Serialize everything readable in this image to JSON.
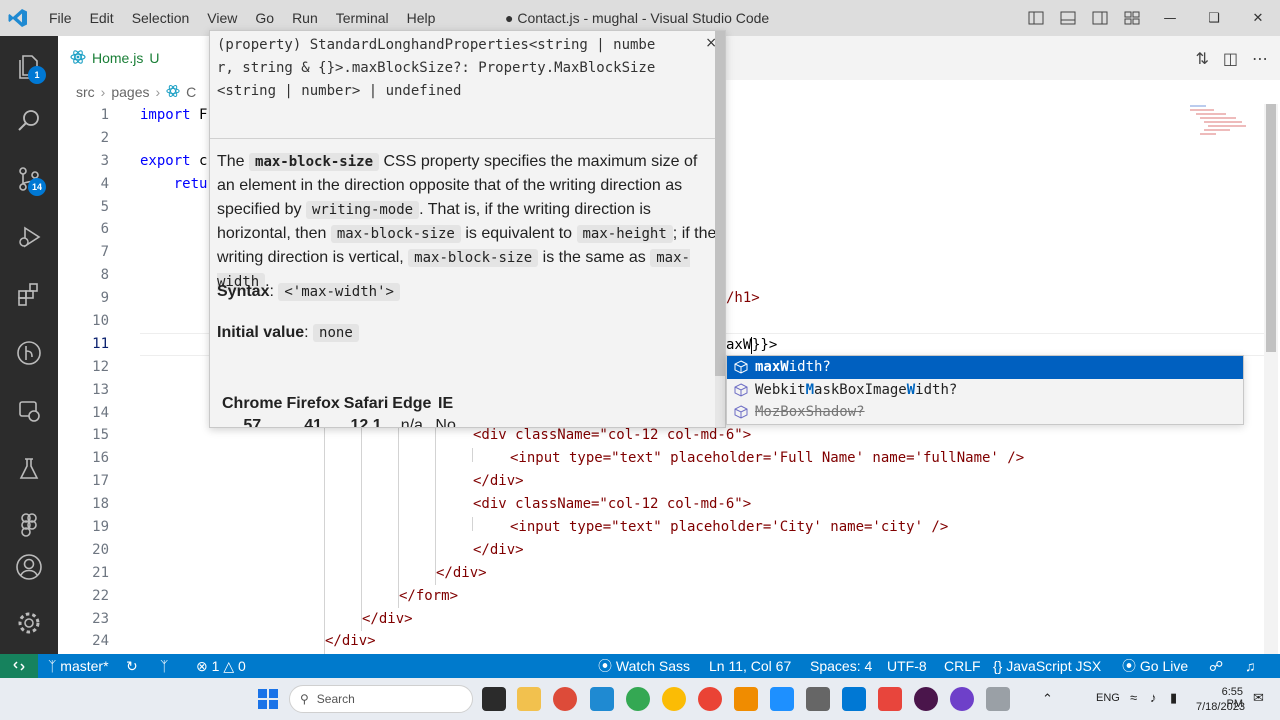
{
  "window": {
    "title": "● Contact.js - mughal - Visual Studio Code",
    "menu": [
      "File",
      "Edit",
      "Selection",
      "View",
      "Go",
      "Run",
      "Terminal",
      "Help"
    ]
  },
  "activity": {
    "explorer_badge": "1",
    "scm_badge": "14"
  },
  "tab": {
    "label": "Home.js",
    "status": "U"
  },
  "breadcrumb": {
    "parts": [
      "src",
      "pages",
      "C"
    ]
  },
  "editor": {
    "line_numbers": [
      "1",
      "2",
      "3",
      "4",
      "5",
      "6",
      "7",
      "8",
      "9",
      "10",
      "11",
      "12",
      "13",
      "14",
      "15",
      "16",
      "17",
      "18",
      "19",
      "20",
      "21",
      "22",
      "23",
      "24"
    ],
    "active_line": "11",
    "lines": {
      "l1_kw": "import",
      "l1_rest": " F",
      "l3_kw": "export",
      "l3_rest": " c",
      "l4": "    retu",
      "l9_tail": "/h1>",
      "l11_tail_a": "axW",
      "l11_tail_b": "}}>",
      "l15": "<div className=\"col-12 col-md-6\">",
      "l16": "<input type=\"text\" placeholder='Full Name' name='fullName' />",
      "l17": "</div>",
      "l18": "<div className=\"col-12 col-md-6\">",
      "l19": "<input type=\"text\" placeholder='City' name='city' />",
      "l20": "</div>",
      "l21": "</div>",
      "l22": "</form>",
      "l23": "</div>",
      "l24": "</div>"
    }
  },
  "hover": {
    "signature_1": "(property) StandardLonghandProperties<string | numbe",
    "signature_2": "r, string & {}>.maxBlockSize?: Property.MaxBlockSize",
    "signature_3": "<string | number> | undefined",
    "close": "×",
    "desc": {
      "p1": "The ",
      "c1": "max-block-size",
      "p2": " CSS property specifies the maximum size of an element in the direction opposite that of the writing direction as specified by ",
      "c2": "writing-mode",
      "p3": ". That is, if the writing direction is horizontal, then ",
      "c3": "max-block-size",
      "p4": " is equivalent to ",
      "c4": "max-height",
      "p5": "; if the writing direction is vertical, ",
      "c5": "max-block-size",
      "p6": " is the same as ",
      "c6": "max-width",
      "p7": "."
    },
    "syntax_label": "Syntax",
    "syntax_value": "<'max-width'>",
    "initial_label": "Initial value",
    "initial_value": "none",
    "compat_headers": [
      "Chrome",
      "Firefox",
      "Safari",
      "Edge",
      "IE"
    ],
    "compat_values": [
      "57",
      "41",
      "12.1",
      "n/a",
      "No"
    ]
  },
  "suggest": {
    "items": [
      {
        "pre": "",
        "hl1": "maxW",
        "mid": "idth?",
        "hl2": "",
        "post": ""
      },
      {
        "pre": "Webkit",
        "hl1": "M",
        "mid": "askBoxImage",
        "hl2": "W",
        "post": "idth?"
      },
      {
        "pre": "",
        "hl1": "",
        "mid": "MozBoxShadow?",
        "hl2": "",
        "post": ""
      }
    ]
  },
  "status": {
    "branch": "master*",
    "errors": "1",
    "warnings": "0",
    "watch_sass": "Watch Sass",
    "position": "Ln 11, Col 67",
    "spaces": "Spaces: 4",
    "encoding": "UTF-8",
    "eol": "CRLF",
    "language": "JavaScript JSX",
    "go_live": "Go Live"
  },
  "taskbar": {
    "search_placeholder": "Search",
    "lang": "ENG",
    "time": "6:55 PM",
    "date": "7/18/2023"
  },
  "colors": {
    "activitybar": "#2c2c2c",
    "statusbar": "#007acc",
    "selection": "#0060c0"
  }
}
